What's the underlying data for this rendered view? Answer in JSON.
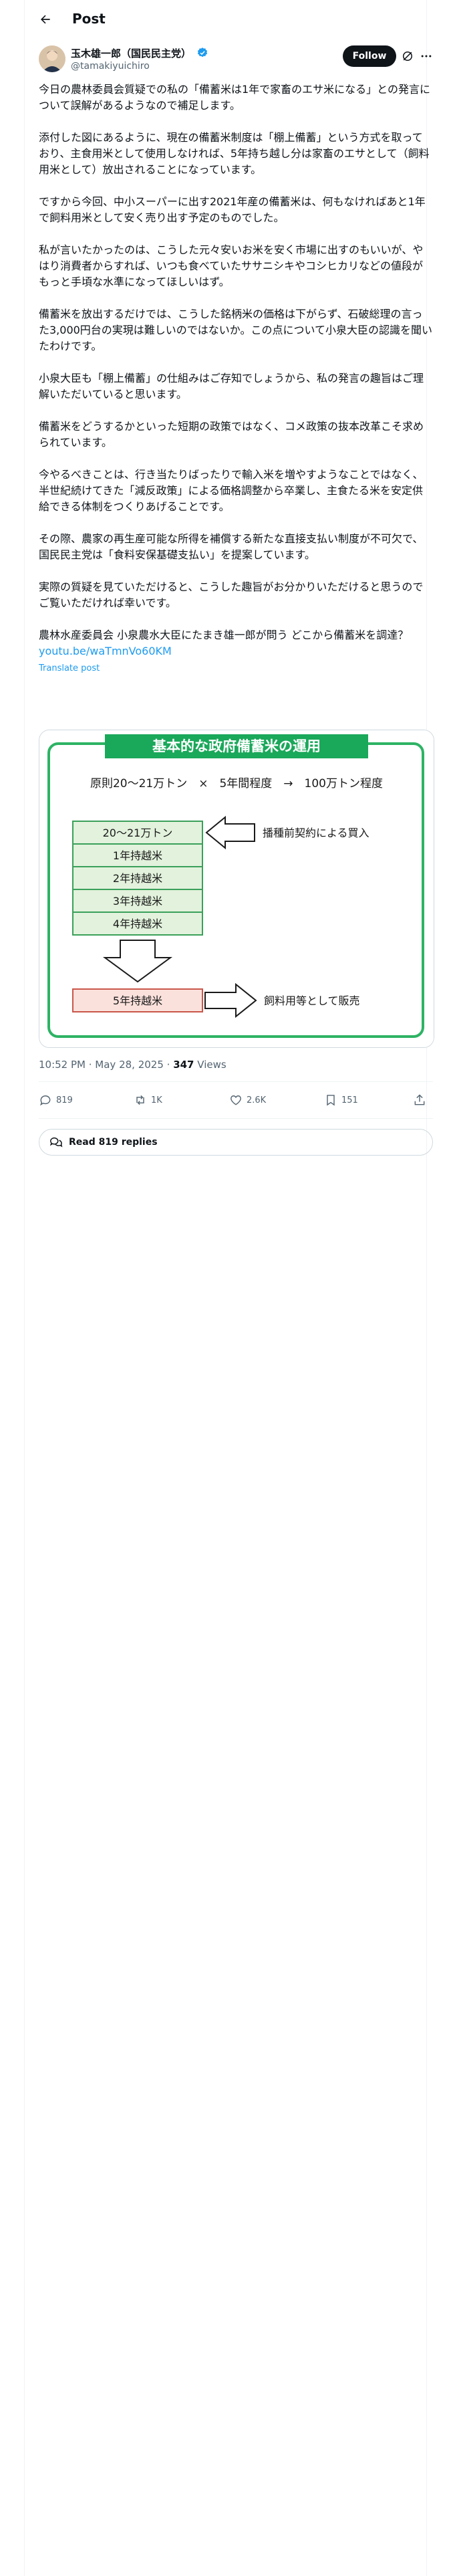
{
  "header": {
    "title": "Post"
  },
  "author": {
    "name": "玉木雄一郎（国民民主党）",
    "handle": "@tamakiyuichiro",
    "follow_label": "Follow"
  },
  "tweet": {
    "paragraphs": [
      "今日の農林委員会質疑での私の「備蓄米は1年で家畜のエサ米になる」との発言について誤解があるようなので補足します。",
      "添付した図にあるように、現在の備蓄米制度は「棚上備蓄」という方式を取っており、主食用米として使用しなければ、5年持ち越し分は家畜のエサとして（飼料用米として）放出されることになっています。",
      "ですから今回、中小スーパーに出す2021年産の備蓄米は、何もなければあと1年で飼料用米として安く売り出す予定のものでした。",
      "私が言いたかったのは、こうした元々安いお米を安く市場に出すのもいいが、やはり消費者からすれば、いつも食べていたササニシキやコシヒカリなどの値段がもっと手頃な水準になってほしいはず。",
      "備蓄米を放出するだけでは、こうした銘柄米の価格は下がらず、石破総理の言った3,000円台の実現は難しいのではないか。この点について小泉大臣の認識を聞いたわけです。",
      "小泉大臣も「棚上備蓄」の仕組みはご存知でしょうから、私の発言の趣旨はご理解いただいていると思います。",
      "備蓄米をどうするかといった短期の政策ではなく、コメ政策の抜本改革こそ求められています。",
      "今やるべきことは、行き当たりばったりで輸入米を増やすようなことではなく、半世紀続けてきた「減反政策」による価格調整から卒業し、主食たる米を安定供給できる体制をつくりあげることです。",
      "その際、農家の再生産可能な所得を補償する新たな直接支払い制度が不可欠で、国民民主党は「食料安保基礎支払い」を提案しています。",
      "実際の質疑を見ていただけると、こうした趣旨がお分かりいただけると思うのでご覧いただければ幸いです。",
      "農林水産委員会 小泉農水大臣にたまき雄一郎が問う どこから備蓄米を調達？"
    ],
    "link": "youtu.be/waTmnVo60KM",
    "translate_label": "Translate post"
  },
  "infographic": {
    "title": "基本的な政府備蓄米の運用",
    "formula": "原則20～21万トン　×　5年間程度　→　100万トン程度",
    "rows": [
      "20～21万トン",
      "1年持越米",
      "2年持越米",
      "3年持越米",
      "4年持越米"
    ],
    "purchase_label": "播種前契約による買入",
    "final_row": "5年持越米",
    "sale_label": "飼料用等として販売",
    "colors": {
      "title_bar": "#1aa85a",
      "border": "#2db364",
      "cell_bg": "#e2f2dc",
      "cell_border": "#3aa05a",
      "final_bg": "#fbe1dc",
      "final_border": "#c9564a"
    }
  },
  "meta": {
    "time": "10:52 PM · May 28, 2025",
    "dot": " · ",
    "views_count": "347",
    "views_label": "Views"
  },
  "stats": {
    "replies": "819",
    "reposts": "1K",
    "likes": "2.6K",
    "bookmarks": "151"
  },
  "read_replies_label": "Read 819 replies",
  "icons": [
    "back-arrow-icon",
    "verified-badge-icon",
    "grok-icon",
    "more-icon",
    "reply-icon",
    "repost-icon",
    "like-icon",
    "bookmark-icon",
    "share-icon",
    "chat-bubbles-icon"
  ]
}
